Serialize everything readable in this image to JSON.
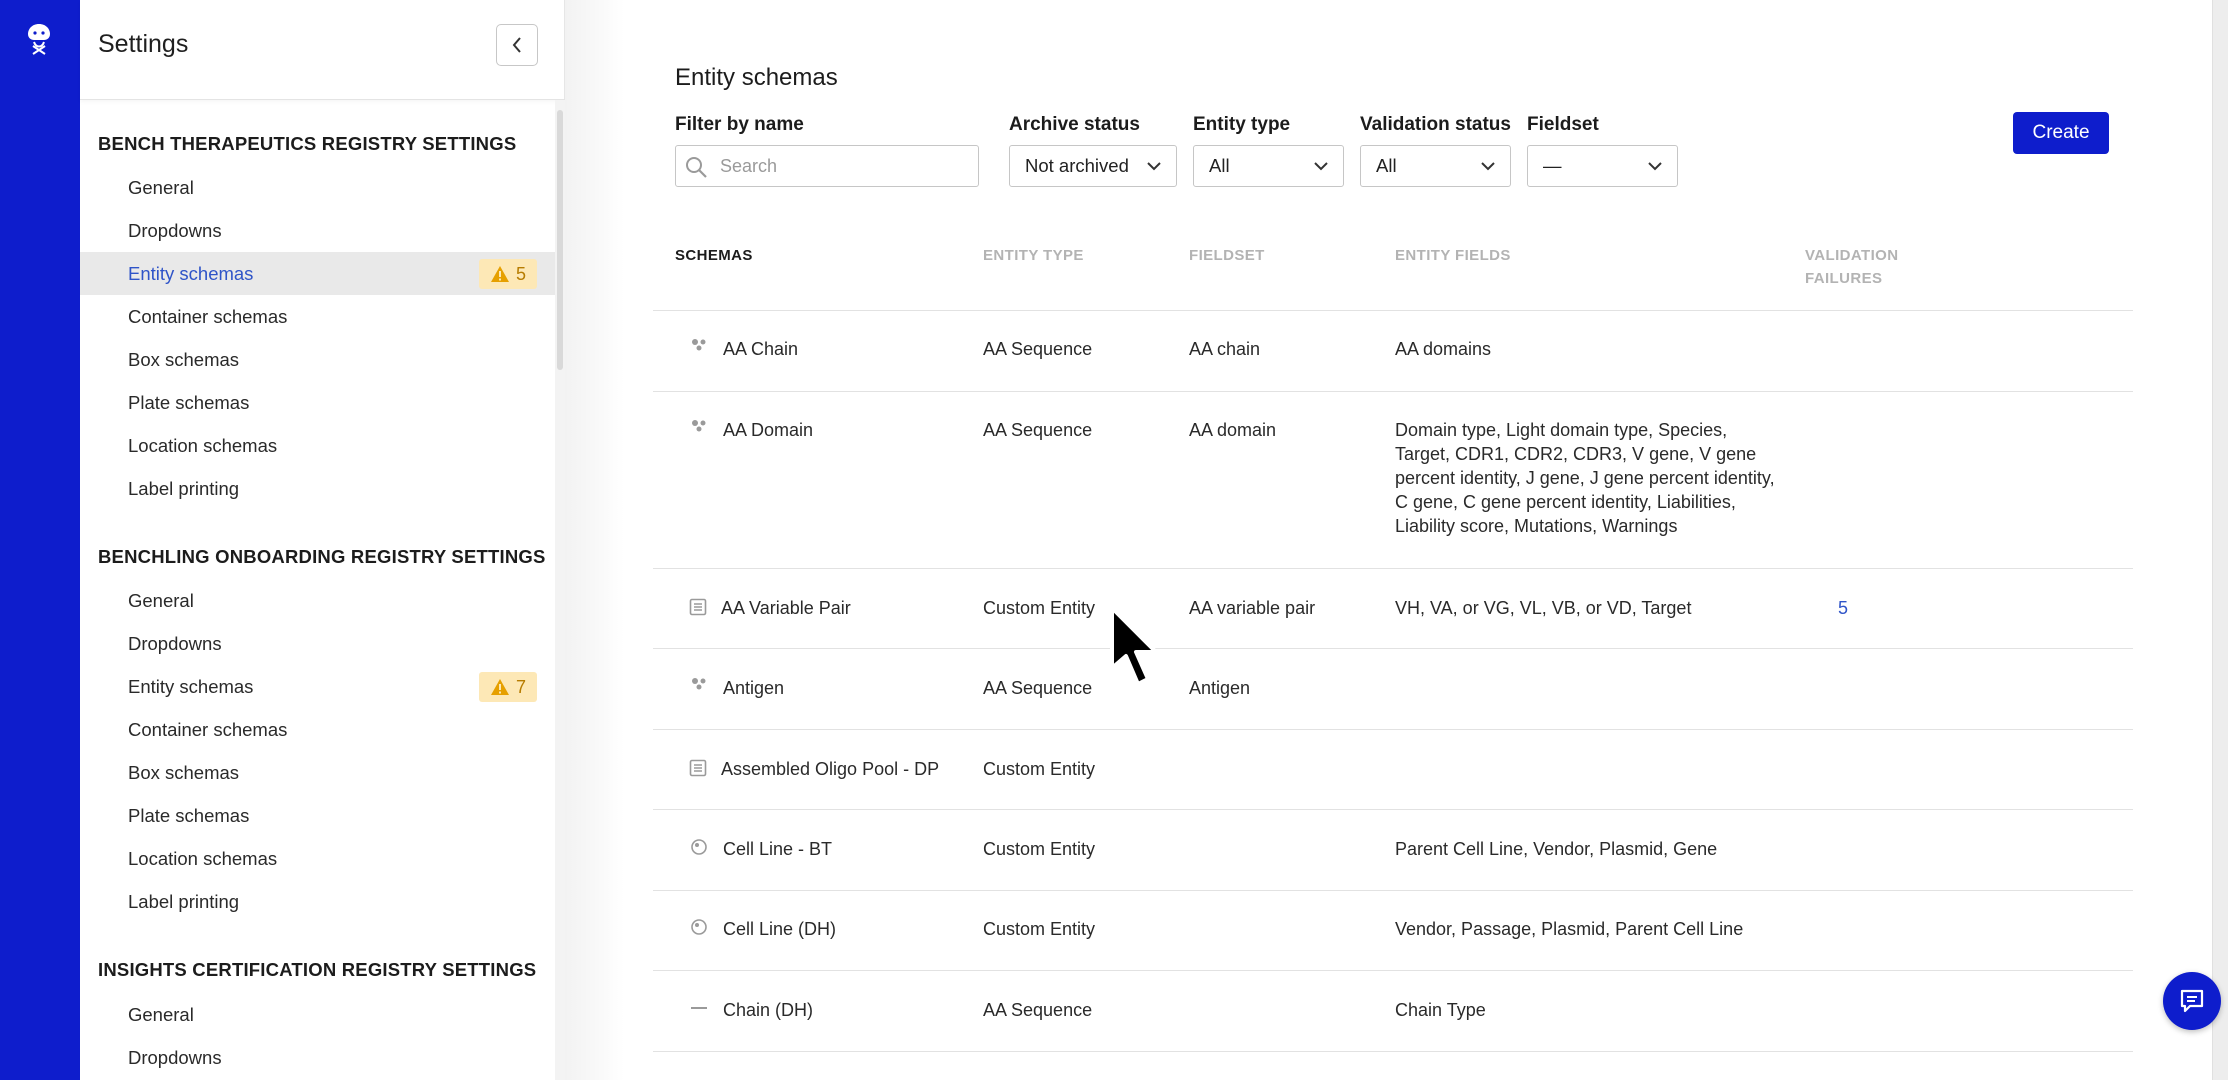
{
  "colors": {
    "brand": "#0e1dcc",
    "link": "#2f54c8",
    "warning_bg": "#fde8b6",
    "warning_fg": "#b77c00"
  },
  "sidebar": {
    "title": "Settings",
    "sections": [
      {
        "title": "BENCH THERAPEUTICS REGISTRY SETTINGS",
        "items": [
          {
            "label": "General"
          },
          {
            "label": "Dropdowns"
          },
          {
            "label": "Entity schemas",
            "badge": "5",
            "active": true
          },
          {
            "label": "Container schemas"
          },
          {
            "label": "Box schemas"
          },
          {
            "label": "Plate schemas"
          },
          {
            "label": "Location schemas"
          },
          {
            "label": "Label printing"
          }
        ]
      },
      {
        "title": "BENCHLING ONBOARDING REGISTRY SETTINGS",
        "items": [
          {
            "label": "General"
          },
          {
            "label": "Dropdowns"
          },
          {
            "label": "Entity schemas",
            "badge": "7"
          },
          {
            "label": "Container schemas"
          },
          {
            "label": "Box schemas"
          },
          {
            "label": "Plate schemas"
          },
          {
            "label": "Location schemas"
          },
          {
            "label": "Label printing"
          }
        ]
      },
      {
        "title": "INSIGHTS CERTIFICATION REGISTRY SETTINGS",
        "items": [
          {
            "label": "General"
          },
          {
            "label": "Dropdowns"
          }
        ]
      }
    ]
  },
  "main": {
    "title": "Entity schemas",
    "filters": {
      "name": {
        "label": "Filter by name",
        "placeholder": "Search"
      },
      "archive": {
        "label": "Archive status",
        "value": "Not archived"
      },
      "entity_type": {
        "label": "Entity type",
        "value": "All"
      },
      "validation": {
        "label": "Validation status",
        "value": "All"
      },
      "fieldset": {
        "label": "Fieldset",
        "value": "—"
      }
    },
    "create_label": "Create",
    "table": {
      "headers": {
        "schemas": "SCHEMAS",
        "entity_type": "ENTITY TYPE",
        "fieldset": "FIELDSET",
        "entity_fields": "ENTITY FIELDS",
        "validation_1": "VALIDATION",
        "validation_2": "FAILURES"
      },
      "rows": [
        {
          "icon": "sequence-icon",
          "name": "AA Chain",
          "entity_type": "AA Sequence",
          "fieldset": "AA chain",
          "fields": "AA domains",
          "failures": ""
        },
        {
          "icon": "sequence-icon",
          "name": "AA Domain",
          "entity_type": "AA Sequence",
          "fieldset": "AA domain",
          "fields": "Domain type, Light domain type, Species, Target, CDR1, CDR2, CDR3, V gene, V gene percent identity, J gene, J gene percent identity, C gene, C gene percent identity, Liabilities, Liability score, Mutations, Warnings",
          "failures": ""
        },
        {
          "icon": "custom-entity-icon",
          "name": "AA Variable Pair",
          "entity_type": "Custom Entity",
          "fieldset": "AA variable pair",
          "fields": "VH, VA, or VG, VL, VB, or VD, Target",
          "failures": "5"
        },
        {
          "icon": "sequence-icon",
          "name": "Antigen",
          "entity_type": "AA Sequence",
          "fieldset": "Antigen",
          "fields": "",
          "failures": ""
        },
        {
          "icon": "custom-entity-icon",
          "name": "Assembled Oligo Pool - DP",
          "entity_type": "Custom Entity",
          "fieldset": "",
          "fields": "",
          "failures": ""
        },
        {
          "icon": "cell-line-icon",
          "name": "Cell Line - BT",
          "entity_type": "Custom Entity",
          "fieldset": "",
          "fields": "Parent Cell Line, Vendor, Plasmid, Gene",
          "failures": ""
        },
        {
          "icon": "cell-line-icon",
          "name": "Cell Line (DH)",
          "entity_type": "Custom Entity",
          "fieldset": "",
          "fields": "Vendor, Passage, Plasmid, Parent Cell Line",
          "failures": ""
        },
        {
          "icon": "dash-icon",
          "name": "Chain (DH)",
          "entity_type": "AA Sequence",
          "fieldset": "",
          "fields": "Chain Type",
          "failures": ""
        }
      ]
    }
  }
}
